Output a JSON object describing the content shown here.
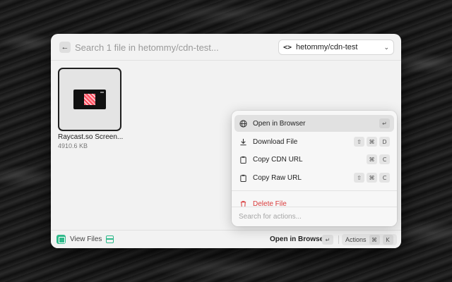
{
  "search": {
    "placeholder": "Search 1 file in hetommy/cdn-test...",
    "repo": "hetommy/cdn-test"
  },
  "file": {
    "name": "Raycast.so Screen...",
    "size": "4910.6 KB"
  },
  "actions": {
    "items": [
      {
        "label": "Open in Browser",
        "icon": "globe-icon",
        "keys": [
          "↵"
        ]
      },
      {
        "label": "Download File",
        "icon": "download-icon",
        "keys": [
          "⇧",
          "⌘",
          "D"
        ]
      },
      {
        "label": "Copy CDN URL",
        "icon": "clipboard-icon",
        "keys": [
          "⌘",
          "C"
        ]
      },
      {
        "label": "Copy Raw URL",
        "icon": "clipboard-icon",
        "keys": [
          "⇧",
          "⌘",
          "C"
        ]
      }
    ],
    "danger": {
      "label": "Delete File",
      "icon": "trash-icon"
    },
    "search_placeholder": "Search for actions..."
  },
  "footer": {
    "title": "View Files",
    "primary_action": "Open in Browser",
    "primary_key": "↵",
    "actions_label": "Actions",
    "actions_keys": [
      "⌘",
      "K"
    ]
  },
  "colors": {
    "accent": "#2fb98a",
    "danger": "#d93b3b"
  }
}
